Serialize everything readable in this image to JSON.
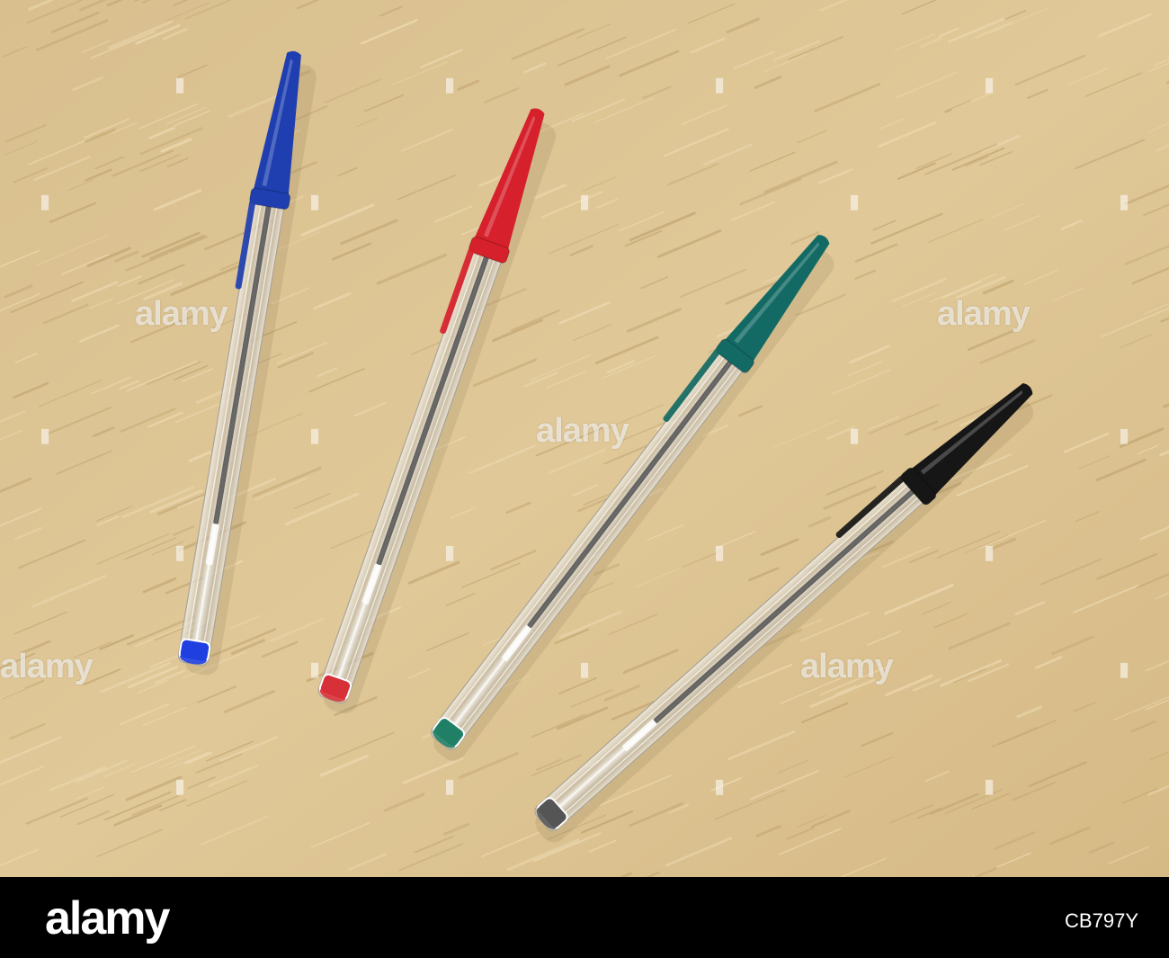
{
  "photo": {
    "subject": "four ballpoint pens on wooden surface",
    "surface_color": "#dcc291",
    "pens": [
      {
        "name": "blue",
        "cap_color": "#1f3fb0",
        "plug_color": "#1f3fe0"
      },
      {
        "name": "red",
        "cap_color": "#d6202c",
        "plug_color": "#d83038"
      },
      {
        "name": "green",
        "cap_color": "#136a64",
        "plug_color": "#1f8066"
      },
      {
        "name": "black",
        "cap_color": "#161616",
        "plug_color": "#555555"
      }
    ]
  },
  "watermark": {
    "text": "alamy"
  },
  "footer": {
    "logo": "alamy",
    "image_id": "CB797Y"
  }
}
